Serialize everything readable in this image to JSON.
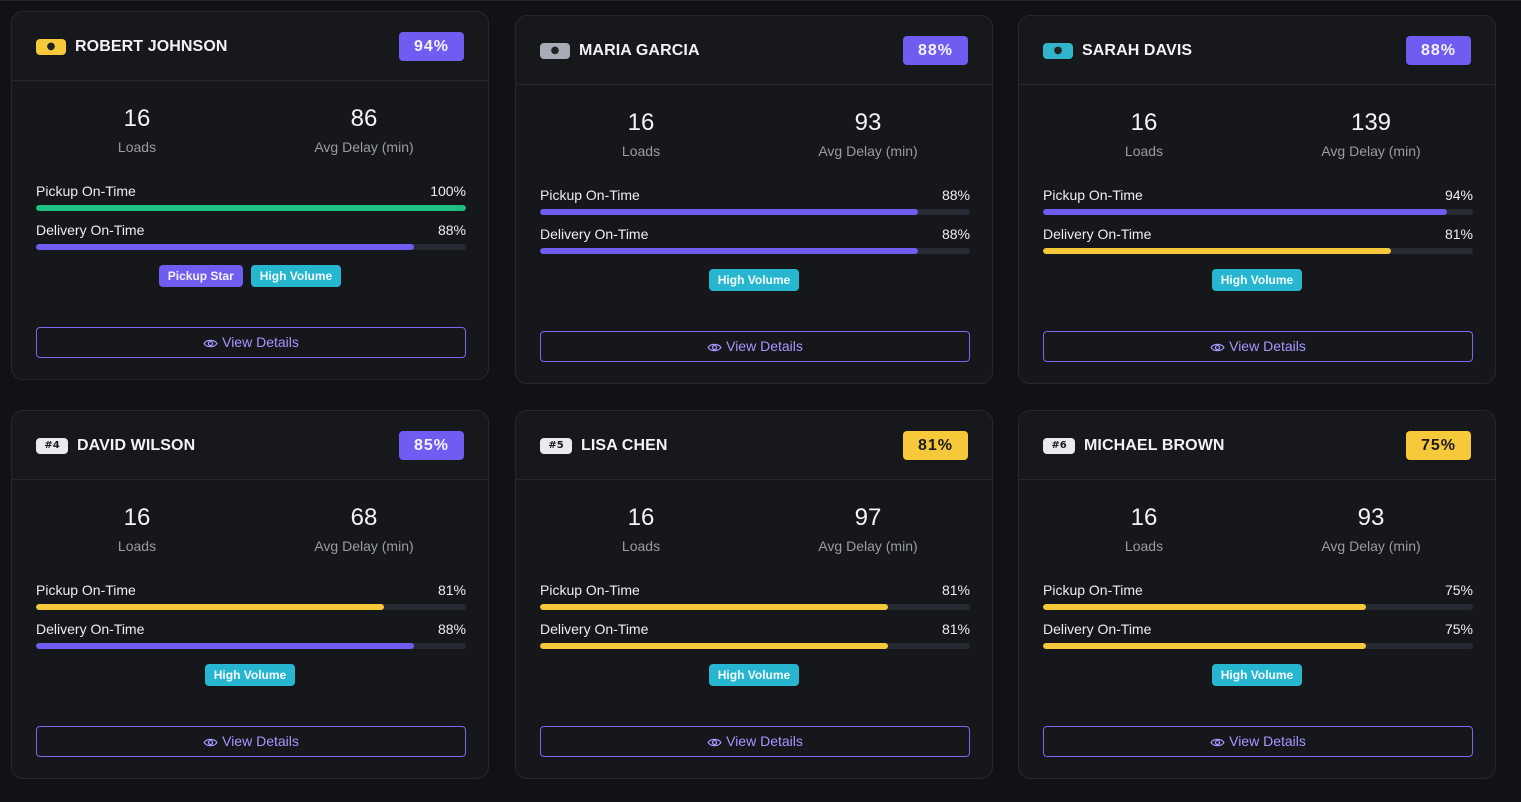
{
  "colors": {
    "purple": "#6f5cf0",
    "yellow": "#f6c93a",
    "green": "#1fbf83",
    "cyan": "#26b6cf"
  },
  "labels": {
    "loads": "Loads",
    "avg_delay": "Avg Delay (min)",
    "pickup": "Pickup On-Time",
    "delivery": "Delivery On-Time",
    "view_details": "View Details"
  },
  "drivers": [
    {
      "rank": "",
      "rank_icon": "gold-medal-icon",
      "name": "ROBERT JOHNSON",
      "score": "94%",
      "score_color": "purple",
      "loads": "16",
      "avg_delay": "86",
      "pickup": "100%",
      "pickup_value": 100,
      "pickup_color": "green",
      "delivery": "88%",
      "delivery_value": 88,
      "delivery_color": "purple",
      "tags": [
        "Pickup Star",
        "High Volume"
      ]
    },
    {
      "rank": "",
      "rank_icon": "silver-medal-icon",
      "name": "MARIA GARCIA",
      "score": "88%",
      "score_color": "purple",
      "loads": "16",
      "avg_delay": "93",
      "pickup": "88%",
      "pickup_value": 88,
      "pickup_color": "purple",
      "delivery": "88%",
      "delivery_value": 88,
      "delivery_color": "purple",
      "tags": [
        "High Volume"
      ]
    },
    {
      "rank": "",
      "rank_icon": "bronze-medal-icon",
      "name": "SARAH DAVIS",
      "score": "88%",
      "score_color": "purple",
      "loads": "16",
      "avg_delay": "139",
      "pickup": "94%",
      "pickup_value": 94,
      "pickup_color": "purple",
      "delivery": "81%",
      "delivery_value": 81,
      "delivery_color": "yellow",
      "tags": [
        "High Volume"
      ]
    },
    {
      "rank": "#4",
      "rank_icon": "",
      "name": "DAVID WILSON",
      "score": "85%",
      "score_color": "purple",
      "loads": "16",
      "avg_delay": "68",
      "pickup": "81%",
      "pickup_value": 81,
      "pickup_color": "yellow",
      "delivery": "88%",
      "delivery_value": 88,
      "delivery_color": "purple",
      "tags": [
        "High Volume"
      ]
    },
    {
      "rank": "#5",
      "rank_icon": "",
      "name": "LISA CHEN",
      "score": "81%",
      "score_color": "yellow",
      "loads": "16",
      "avg_delay": "97",
      "pickup": "81%",
      "pickup_value": 81,
      "pickup_color": "yellow",
      "delivery": "81%",
      "delivery_value": 81,
      "delivery_color": "yellow",
      "tags": [
        "High Volume"
      ]
    },
    {
      "rank": "#6",
      "rank_icon": "",
      "name": "MICHAEL BROWN",
      "score": "75%",
      "score_color": "yellow",
      "loads": "16",
      "avg_delay": "93",
      "pickup": "75%",
      "pickup_value": 75,
      "pickup_color": "yellow",
      "delivery": "75%",
      "delivery_value": 75,
      "delivery_color": "yellow",
      "tags": [
        "High Volume"
      ]
    }
  ]
}
